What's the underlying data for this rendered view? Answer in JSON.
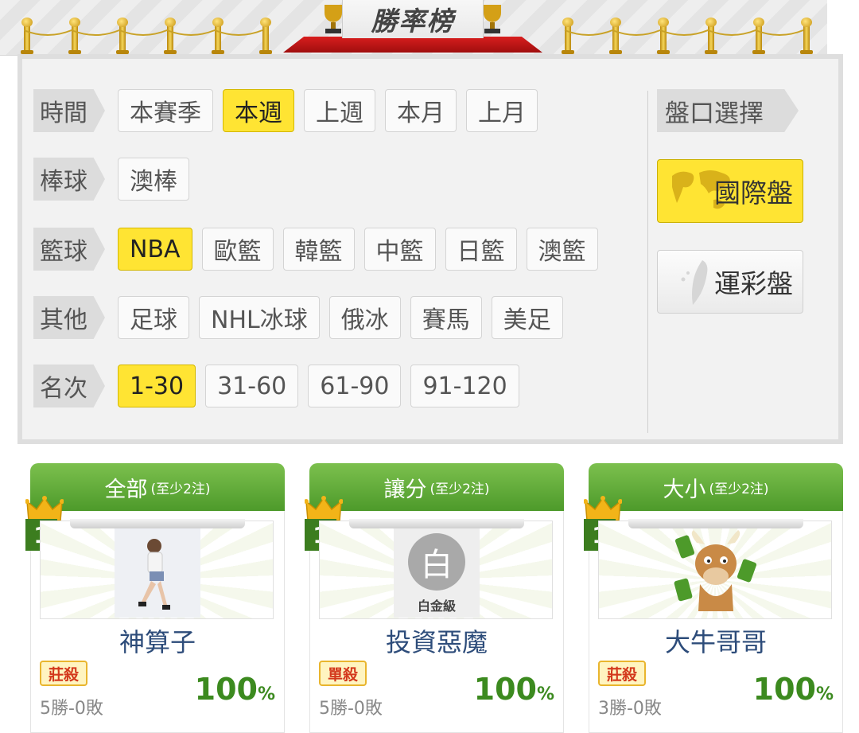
{
  "banner": {
    "title": "勝率榜"
  },
  "filters": {
    "time": {
      "label": "時間",
      "options": [
        "本賽季",
        "本週",
        "上週",
        "本月",
        "上月"
      ],
      "active": "本週"
    },
    "baseball": {
      "label": "棒球",
      "options": [
        "澳棒"
      ]
    },
    "basketball": {
      "label": "籃球",
      "options": [
        "NBA",
        "歐籃",
        "韓籃",
        "中籃",
        "日籃",
        "澳籃"
      ],
      "active": "NBA"
    },
    "other": {
      "label": "其他",
      "options": [
        "足球",
        "NHL冰球",
        "俄冰",
        "賽馬",
        "美足"
      ]
    },
    "rank": {
      "label": "名次",
      "options": [
        "1-30",
        "31-60",
        "61-90",
        "91-120"
      ],
      "active": "1-30"
    }
  },
  "market": {
    "label": "盤口選擇",
    "international": "國際盤",
    "sports_lottery": "運彩盤",
    "active": "國際盤"
  },
  "cards": [
    {
      "title": "全部",
      "note": "(至少2注)",
      "rank": "1",
      "nickname": "神算子",
      "badge": "莊殺",
      "record": "5勝-0敗",
      "percent": "100",
      "percent_sign": "%"
    },
    {
      "title": "讓分",
      "note": "(至少2注)",
      "rank": "1",
      "nickname": "投資惡魔",
      "badge": "單殺",
      "record": "5勝-0敗",
      "percent": "100",
      "percent_sign": "%",
      "avatar_char": "白",
      "avatar_level": "白金級"
    },
    {
      "title": "大小",
      "note": "(至少2注)",
      "rank": "1",
      "nickname": "大牛哥哥",
      "badge": "莊殺",
      "record": "3勝-0敗",
      "percent": "100",
      "percent_sign": "%"
    }
  ],
  "colors": {
    "accent_yellow": "#ffe433",
    "header_green": "#5aa832",
    "rank_green": "#3c7d1f",
    "nick_blue": "#2d4c7a"
  }
}
